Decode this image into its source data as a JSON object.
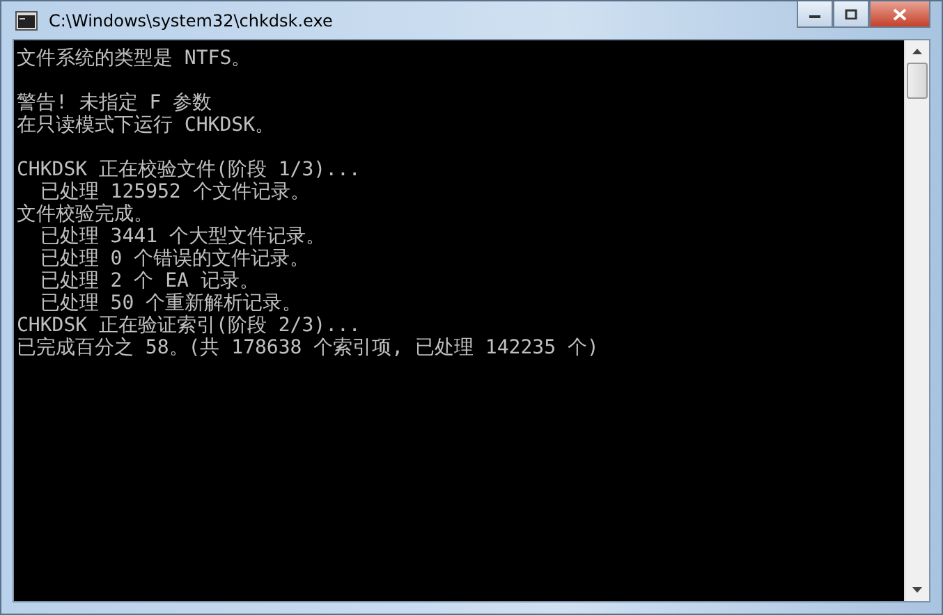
{
  "window": {
    "title": "C:\\Windows\\system32\\chkdsk.exe"
  },
  "console": {
    "blocks": [
      [
        "文件系统的类型是 NTFS。"
      ],
      [
        "警告! 未指定 F 参数",
        "在只读模式下运行 CHKDSK。"
      ],
      [
        "CHKDSK 正在校验文件(阶段 1/3)...",
        "  已处理 125952 个文件记录。",
        "文件校验完成。",
        "  已处理 3441 个大型文件记录。",
        "  已处理 0 个错误的文件记录。",
        "  已处理 2 个 EA 记录。",
        "  已处理 50 个重新解析记录。",
        "CHKDSK 正在验证索引(阶段 2/3)...",
        "已完成百分之 58。(共 178638 个索引项, 已处理 142235 个)"
      ]
    ]
  }
}
